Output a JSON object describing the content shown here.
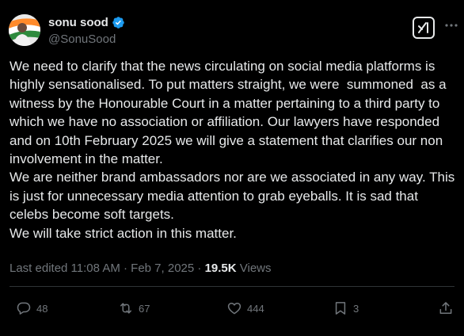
{
  "author": {
    "display_name": "sonu sood",
    "handle": "@SonuSood",
    "verified": true
  },
  "tweet": {
    "text": "We need to clarify that the news circulating on social media platforms is highly sensationalised. To put matters straight, we were  summoned  as a witness by the Honourable Court in a matter pertaining to a third party to which we have no association or affiliation. Our lawyers have responded and on 10th February 2025 we will give a statement that clarifies our non involvement in the matter.\nWe are neither brand ambassadors nor are we associated in any way. This is just for unnecessary media attention to grab eyeballs. It is sad that celebs become soft targets.\nWe will take strict action in this matter."
  },
  "meta": {
    "edited_label": "Last edited 11:08 AM",
    "separator": " · ",
    "date": "Feb 7, 2025",
    "views_count": "19.5K",
    "views_label": " Views"
  },
  "actions": {
    "replies": "48",
    "reposts": "67",
    "likes": "444",
    "bookmarks": "3"
  },
  "icons": {
    "verified": "verified-badge-icon",
    "grok": "grok-icon",
    "more": "more-icon",
    "reply": "reply-icon",
    "repost": "repost-icon",
    "like": "heart-icon",
    "bookmark": "bookmark-icon",
    "share": "share-icon"
  },
  "colors": {
    "background": "#000000",
    "text": "#e7e9ea",
    "secondary_text": "#71767b",
    "verified_blue": "#1d9bf0"
  }
}
